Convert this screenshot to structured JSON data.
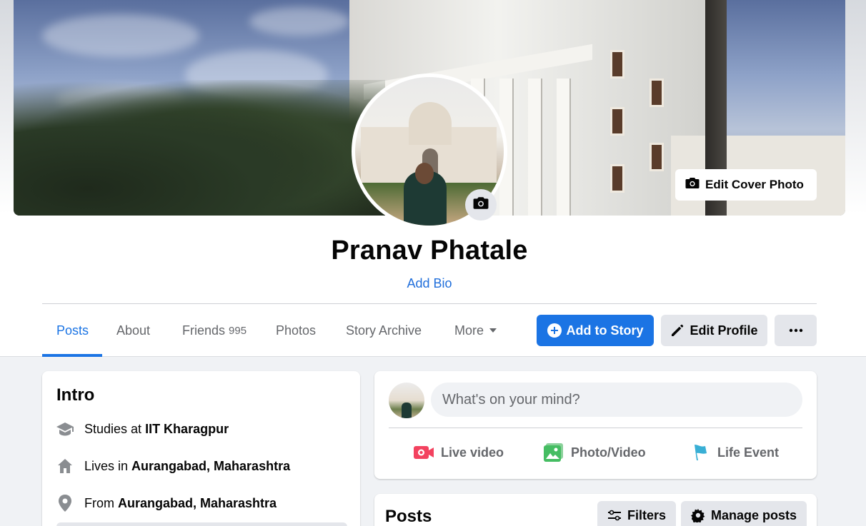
{
  "profile": {
    "name": "Pranav Phatale",
    "add_bio": "Add Bio",
    "edit_cover_label": "Edit Cover Photo"
  },
  "tabs": [
    {
      "label": "Posts",
      "active": true
    },
    {
      "label": "About"
    },
    {
      "label": "Friends",
      "count": "995"
    },
    {
      "label": "Photos"
    },
    {
      "label": "Story Archive"
    },
    {
      "label": "More"
    }
  ],
  "actions": {
    "add_to_story": "Add to Story",
    "edit_profile": "Edit Profile",
    "more_options": "···"
  },
  "intro": {
    "title": "Intro",
    "rows": [
      {
        "icon": "graduation-cap-icon",
        "prefix": "Studies at",
        "value": "IIT Kharagpur"
      },
      {
        "icon": "home-icon",
        "prefix": "Lives in",
        "value": "Aurangabad, Maharashtra"
      },
      {
        "icon": "location-pin-icon",
        "prefix": "From",
        "value": "Aurangabad, Maharashtra"
      }
    ]
  },
  "composer": {
    "placeholder": "What's on your mind?",
    "actions": [
      {
        "label": "Live video",
        "icon": "live-video-icon",
        "color": "#f3425f"
      },
      {
        "label": "Photo/Video",
        "icon": "photo-video-icon",
        "color": "#45bd62"
      },
      {
        "label": "Life Event",
        "icon": "flag-icon",
        "color": "#39afd5"
      }
    ]
  },
  "posts_section": {
    "title": "Posts",
    "filters": "Filters",
    "manage": "Manage posts"
  },
  "colors": {
    "accent": "#1b74e4",
    "background": "#f0f2f5",
    "secondary_button": "#e4e6eb"
  }
}
